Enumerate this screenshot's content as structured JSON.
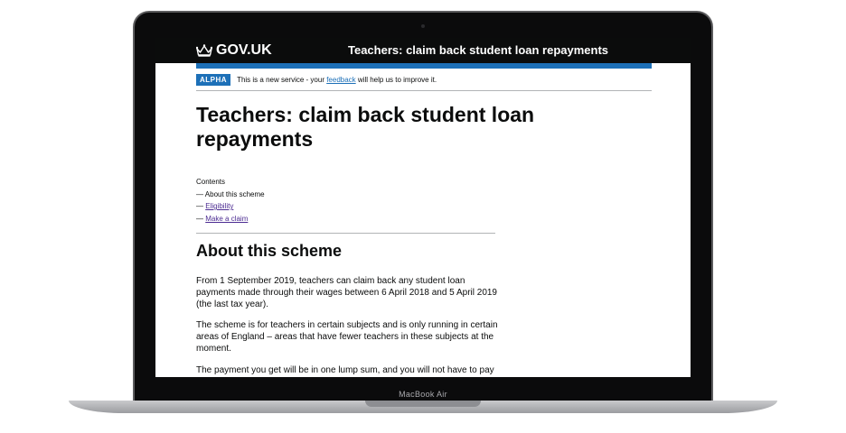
{
  "header": {
    "logo_text": "GOV.UK",
    "service_name": "Teachers: claim back student loan repayments"
  },
  "phase_banner": {
    "tag": "ALPHA",
    "text_before": "This is a new service - your ",
    "link": "feedback",
    "text_after": " will help us to improve it."
  },
  "page_title": "Teachers: claim back student loan repayments",
  "contents": {
    "label": "Contents",
    "dash": "—",
    "items": [
      {
        "label": "About this scheme"
      },
      {
        "label": "Eligibility"
      },
      {
        "label": "Make a claim"
      }
    ]
  },
  "section": {
    "heading": "About this scheme",
    "paragraphs": [
      "From 1 September 2019, teachers can claim back any student loan payments made through their wages between 6 April 2018 and 5 April 2019 (the last tax year).",
      "The scheme is for teachers in certain subjects and is only running in certain areas of England – areas that have fewer teachers in these subjects at the moment.",
      "The payment you get will be in one lump sum, and you will not have to pay tax"
    ]
  },
  "device": {
    "model": "MacBook Air"
  },
  "colors": {
    "header_bg": "#0b0c0c",
    "brand_blue": "#1d70b8",
    "visited_link": "#4c2c92",
    "text": "#0b0c0c"
  },
  "icons": {
    "logo": "crown-icon"
  }
}
